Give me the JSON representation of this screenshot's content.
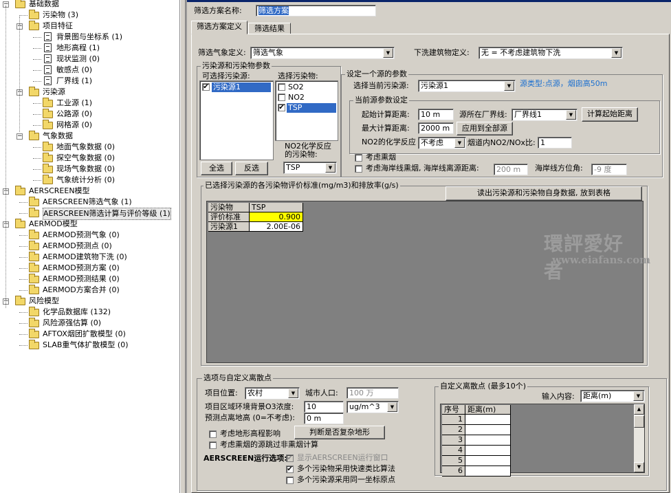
{
  "tree": {
    "root": "基础数据",
    "items": [
      "污染物 (3)",
      "项目特征",
      "背景图与坐标系 (1)",
      "地形高程 (1)",
      "现状监测 (0)",
      "敏感点 (0)",
      "厂界线 (1)",
      "污染源",
      "工业源 (1)",
      "公路源 (0)",
      "网格源 (0)",
      "气象数据",
      "地面气象数据 (0)",
      "探空气象数据 (0)",
      "现场气象数据 (0)",
      "气象统计分析 (0)",
      "AERSCREEN模型",
      "AERSCREEN筛选气象 (1)",
      "AERSCREEN筛选计算与评价等级 (1)",
      "AERMOD模型",
      "AERMOD预测气象 (0)",
      "AERMOD预测点 (0)",
      "AERMOD建筑物下洗 (0)",
      "AERMOD预测方案 (0)",
      "AERMOD预测结果 (0)",
      "AERMOD方案合并 (0)",
      "风险模型",
      "化学品数据库 (132)",
      "风险源强估算 (0)",
      "AFTOX烟团扩散模型 (0)",
      "SLAB重气体扩散模型 (0)"
    ]
  },
  "header": {
    "scheme_name_label": "筛选方案名称:",
    "scheme_name_value": "筛选方案"
  },
  "tabs": [
    "筛选方案定义",
    "筛选结果"
  ],
  "met": {
    "label": "筛选气象定义:",
    "value": "筛选气象"
  },
  "downwash": {
    "label": "下洗建筑物定义:",
    "value": "无 = 不考虑建筑物下洗"
  },
  "sources_group": {
    "title": "污染源和污染物参数",
    "available_label": "可选择污染源:",
    "sources": [
      "污染源1"
    ],
    "pollutant_label": "选择污染物:",
    "pollutants": [
      {
        "name": "SO2",
        "checked": false
      },
      {
        "name": "NO2",
        "checked": false
      },
      {
        "name": "TSP",
        "checked": true
      }
    ],
    "select_all": "全选",
    "invert": "反选",
    "no2_label": "NO2化学反应的污染物:",
    "no2_value": "TSP"
  },
  "one_source": {
    "title": "设定一个源的参数",
    "current_label": "选择当前污染源:",
    "current_value": "污染源1",
    "source_type": "源类型:点源，烟囱高50m",
    "params_title": "当前源参数设定",
    "start_dist_label": "起始计算距离:",
    "start_dist_value": "10 m",
    "boundary_label": "源所在厂界线:",
    "boundary_value": "厂界线1",
    "calc_start_btn": "计算起始距离",
    "max_dist_label": "最大计算距离:",
    "max_dist_value": "2000 m",
    "apply_all_btn": "应用到全部源",
    "no2_chem_label": "NO2的化学反应",
    "no2_chem_value": "不考虑",
    "ratio_label": "烟道内NO2/NOx比:",
    "ratio_value": "1",
    "fumigation": "考虑熏烟",
    "shore_label": "考虑海岸线熏烟, 海岸线离源距离:",
    "shore_value": "200 m",
    "shore_dir_label": "海岸线方位角:",
    "shore_dir_value": "-9 度"
  },
  "std_group": {
    "title": "已选择污染源的各污染物评价标准(mg/m3)和排放率(g/s)",
    "read_btn": "读出污染源和污染物自身数据, 放到表格",
    "grid": [
      [
        "污染物",
        "TSP"
      ],
      [
        "评价标准",
        "0.900"
      ],
      [
        "污染源1",
        "2.00E-06"
      ]
    ]
  },
  "options": {
    "title": "选项与自定义离散点",
    "location_label": "项目位置:",
    "location_value": "农村",
    "pop_label": "城市人口:",
    "pop_value": "100 万",
    "o3_label": "项目区域环境背景O3浓度:",
    "o3_value": "10",
    "o3_unit": "ug/m^3",
    "height_label": "预测点离地高 (0=不考虑):",
    "height_value": "0 m",
    "terrain": "考虑地形高程影响",
    "complex_btn": "判断是否复杂地形",
    "skip_fum": "考虑熏烟的源跳过非熏烟计算",
    "run_label": "AERSCREEN运行选项:",
    "show_window": "显示AERSCREEN运行窗口",
    "fast_alg": "多个污染物采用快速类比算法",
    "same_origin": "多个污染源采用同一坐标原点"
  },
  "custom": {
    "title": "自定义离散点 (最多10个)",
    "input_label": "输入内容:",
    "input_value": "距离(m)",
    "cols": [
      "序号",
      "距离(m)"
    ],
    "rows": [
      "1",
      "2",
      "3",
      "4",
      "5",
      "6"
    ]
  },
  "watermark": {
    "cn": "環評愛好者",
    "en": "www.eiafans.com"
  }
}
